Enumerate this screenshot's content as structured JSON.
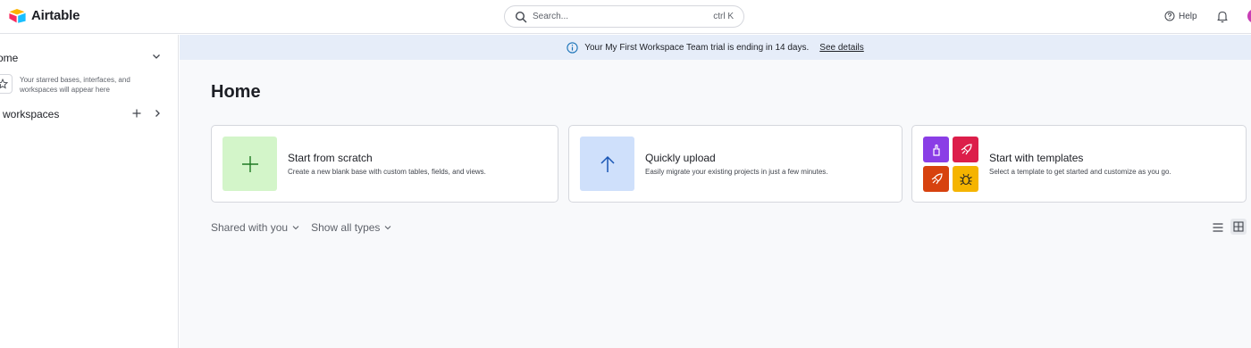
{
  "app": {
    "name": "Airtable"
  },
  "search": {
    "placeholder": "Search...",
    "shortcut": "ctrl K"
  },
  "header": {
    "help_label": "Help"
  },
  "sidebar": {
    "home_label": "ome",
    "starred_empty_text": "Your starred bases, interfaces, and workspaces will appear here",
    "workspaces_label": "l workspaces"
  },
  "banner": {
    "message": "Your My First Workspace Team trial is ending in 14 days.",
    "link": "See details"
  },
  "main": {
    "title": "Home",
    "cards": [
      {
        "title": "Start from scratch",
        "description": "Create a new blank base with custom tables, fields, and views."
      },
      {
        "title": "Quickly upload",
        "description": "Easily migrate your existing projects in just a few minutes."
      },
      {
        "title": "Start with templates",
        "description": "Select a template to get started and customize as you go."
      }
    ],
    "filters": {
      "owner": "Shared with you",
      "type": "Show all types"
    }
  },
  "colors": {
    "banner_bg": "#e6edf9",
    "scratch_tile": "#d3f5c9",
    "upload_tile": "#cfe0fb",
    "template_purple": "#8a3ee6",
    "template_red": "#dc1e4a",
    "template_orange": "#d7420f",
    "template_yellow": "#f5b400"
  },
  "icons": [
    "airtable-logo",
    "search-icon",
    "help-icon",
    "bell-icon",
    "chevron-down-icon",
    "star-icon",
    "plus-icon",
    "chevron-right-icon",
    "info-icon",
    "arrow-up-icon",
    "list-view-icon",
    "grid-view-icon"
  ]
}
